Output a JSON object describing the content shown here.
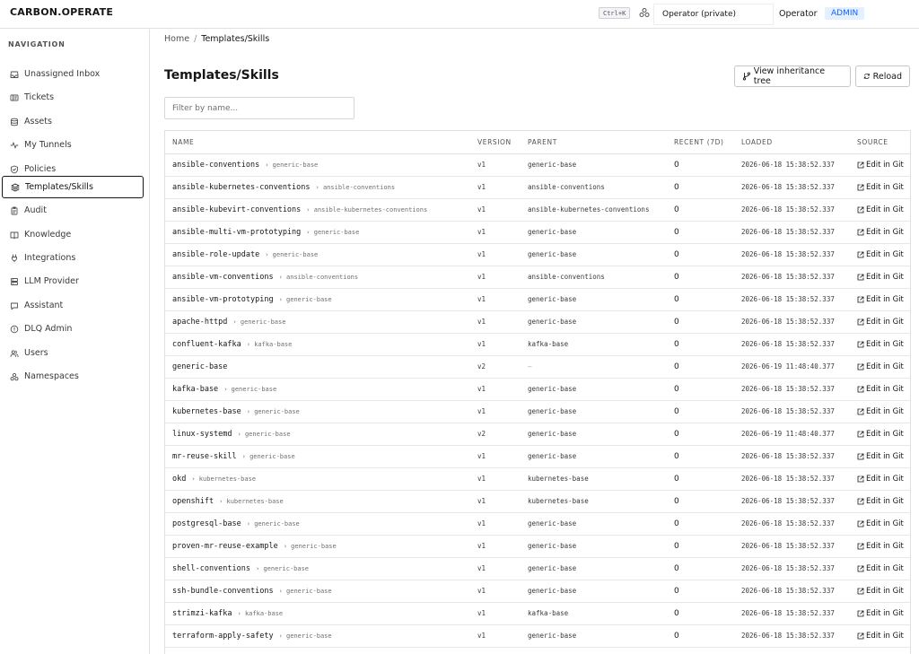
{
  "header": {
    "brand": "CARBON.OPERATE",
    "shortcut": "Ctrl+K",
    "operator_selector": "Operator (private)",
    "user_name": "Operator",
    "role": "ADMIN"
  },
  "sidebar": {
    "heading": "NAVIGATION",
    "active": "Templates/Skills",
    "items": [
      {
        "label": "Unassigned Inbox",
        "icon": "inbox-icon"
      },
      {
        "label": "Tickets",
        "icon": "ticket-icon"
      },
      {
        "label": "Assets",
        "icon": "database-icon"
      },
      {
        "label": "My Tunnels",
        "icon": "tunnel-icon"
      },
      {
        "label": "Policies",
        "icon": "shield-icon"
      },
      {
        "label": "Templates/Skills",
        "icon": "layers-icon"
      },
      {
        "label": "Audit",
        "icon": "clipboard-icon"
      },
      {
        "label": "Knowledge",
        "icon": "book-icon"
      },
      {
        "label": "Integrations",
        "icon": "plug-icon"
      },
      {
        "label": "LLM Provider",
        "icon": "server-icon"
      },
      {
        "label": "Assistant",
        "icon": "chat-icon"
      },
      {
        "label": "DLQ Admin",
        "icon": "alert-icon"
      },
      {
        "label": "Users",
        "icon": "users-icon"
      },
      {
        "label": "Namespaces",
        "icon": "namespaces-icon"
      }
    ]
  },
  "breadcrumb": {
    "home": "Home",
    "separator": "/",
    "current": "Templates/Skills"
  },
  "page": {
    "title": "Templates/Skills",
    "view_tree_label": "View inheritance tree",
    "reload_label": "Reload",
    "filter_placeholder": "Filter by name..."
  },
  "table": {
    "columns": [
      "NAME",
      "VERSION",
      "PARENT",
      "RECENT (7D)",
      "LOADED",
      "SOURCE"
    ],
    "rows": [
      {
        "name": "ansible-conventions",
        "parent": "generic-base",
        "version": "v1",
        "recent": "0",
        "loaded": "2026-06-18 15:38:52.337",
        "source": "Edit in Git"
      },
      {
        "name": "ansible-kubernetes-conventions",
        "parent": "ansible-conventions",
        "version": "v1",
        "recent": "0",
        "loaded": "2026-06-18 15:38:52.337",
        "source": "Edit in Git"
      },
      {
        "name": "ansible-kubevirt-conventions",
        "parent": "ansible-kubernetes-conventions",
        "version": "v1",
        "recent": "0",
        "loaded": "2026-06-18 15:38:52.337",
        "source": "Edit in Git"
      },
      {
        "name": "ansible-multi-vm-prototyping",
        "parent": "generic-base",
        "version": "v1",
        "recent": "0",
        "loaded": "2026-06-18 15:38:52.337",
        "source": "Edit in Git"
      },
      {
        "name": "ansible-role-update",
        "parent": "generic-base",
        "version": "v1",
        "recent": "0",
        "loaded": "2026-06-18 15:38:52.337",
        "source": "Edit in Git"
      },
      {
        "name": "ansible-vm-conventions",
        "parent": "ansible-conventions",
        "version": "v1",
        "recent": "0",
        "loaded": "2026-06-18 15:38:52.337",
        "source": "Edit in Git"
      },
      {
        "name": "ansible-vm-prototyping",
        "parent": "generic-base",
        "version": "v1",
        "recent": "0",
        "loaded": "2026-06-18 15:38:52.337",
        "source": "Edit in Git"
      },
      {
        "name": "apache-httpd",
        "parent": "generic-base",
        "version": "v1",
        "recent": "0",
        "loaded": "2026-06-18 15:38:52.337",
        "source": "Edit in Git"
      },
      {
        "name": "confluent-kafka",
        "parent": "kafka-base",
        "version": "v1",
        "recent": "0",
        "loaded": "2026-06-18 15:38:52.337",
        "source": "Edit in Git"
      },
      {
        "name": "generic-base",
        "parent": "",
        "parent_display": "—",
        "version": "v2",
        "recent": "0",
        "loaded": "2026-06-19 11:48:40.377",
        "source": "Edit in Git"
      },
      {
        "name": "kafka-base",
        "parent": "generic-base",
        "version": "v1",
        "recent": "0",
        "loaded": "2026-06-18 15:38:52.337",
        "source": "Edit in Git"
      },
      {
        "name": "kubernetes-base",
        "parent": "generic-base",
        "version": "v1",
        "recent": "0",
        "loaded": "2026-06-18 15:38:52.337",
        "source": "Edit in Git"
      },
      {
        "name": "linux-systemd",
        "parent": "generic-base",
        "version": "v2",
        "recent": "0",
        "loaded": "2026-06-19 11:48:40.377",
        "source": "Edit in Git"
      },
      {
        "name": "mr-reuse-skill",
        "parent": "generic-base",
        "version": "v1",
        "recent": "0",
        "loaded": "2026-06-18 15:38:52.337",
        "source": "Edit in Git"
      },
      {
        "name": "okd",
        "parent": "kubernetes-base",
        "version": "v1",
        "recent": "0",
        "loaded": "2026-06-18 15:38:52.337",
        "source": "Edit in Git"
      },
      {
        "name": "openshift",
        "parent": "kubernetes-base",
        "version": "v1",
        "recent": "0",
        "loaded": "2026-06-18 15:38:52.337",
        "source": "Edit in Git"
      },
      {
        "name": "postgresql-base",
        "parent": "generic-base",
        "version": "v1",
        "recent": "0",
        "loaded": "2026-06-18 15:38:52.337",
        "source": "Edit in Git"
      },
      {
        "name": "proven-mr-reuse-example",
        "parent": "generic-base",
        "version": "v1",
        "recent": "0",
        "loaded": "2026-06-18 15:38:52.337",
        "source": "Edit in Git"
      },
      {
        "name": "shell-conventions",
        "parent": "generic-base",
        "version": "v1",
        "recent": "0",
        "loaded": "2026-06-18 15:38:52.337",
        "source": "Edit in Git"
      },
      {
        "name": "ssh-bundle-conventions",
        "parent": "generic-base",
        "version": "v1",
        "recent": "0",
        "loaded": "2026-06-18 15:38:52.337",
        "source": "Edit in Git"
      },
      {
        "name": "strimzi-kafka",
        "parent": "kafka-base",
        "version": "v1",
        "recent": "0",
        "loaded": "2026-06-18 15:38:52.337",
        "source": "Edit in Git"
      },
      {
        "name": "terraform-apply-safety",
        "parent": "generic-base",
        "version": "v1",
        "recent": "0",
        "loaded": "2026-06-18 15:38:52.337",
        "source": "Edit in Git"
      }
    ]
  }
}
